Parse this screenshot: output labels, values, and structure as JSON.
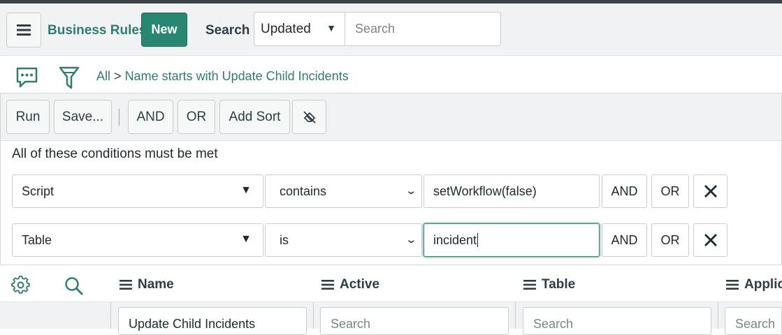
{
  "header": {
    "title": "Business Rules",
    "new_label": "New",
    "search_label": "Search",
    "search_field_selected": "Updated",
    "search_placeholder": "Search"
  },
  "breadcrumb": {
    "all": "All",
    "separator": ">",
    "condition": "Name starts with Update Child Incidents"
  },
  "filter_toolbar": {
    "run": "Run",
    "save": "Save...",
    "and": "AND",
    "or": "OR",
    "add_sort": "Add Sort"
  },
  "conditions": {
    "heading": "All of these conditions must be met",
    "rows": [
      {
        "field": "Script",
        "operator": "contains",
        "value": "setWorkflow(false)",
        "and": "AND",
        "or": "OR"
      },
      {
        "field": "Table",
        "operator": "is",
        "value": "incident",
        "and": "AND",
        "or": "OR"
      }
    ]
  },
  "list": {
    "columns": [
      "Name",
      "Active",
      "Table",
      "Applica"
    ],
    "filters": [
      "Update Child Incidents",
      "Search",
      "Search",
      "Search"
    ]
  },
  "colors": {
    "accent": "#278770",
    "link": "#2e7d6e"
  }
}
